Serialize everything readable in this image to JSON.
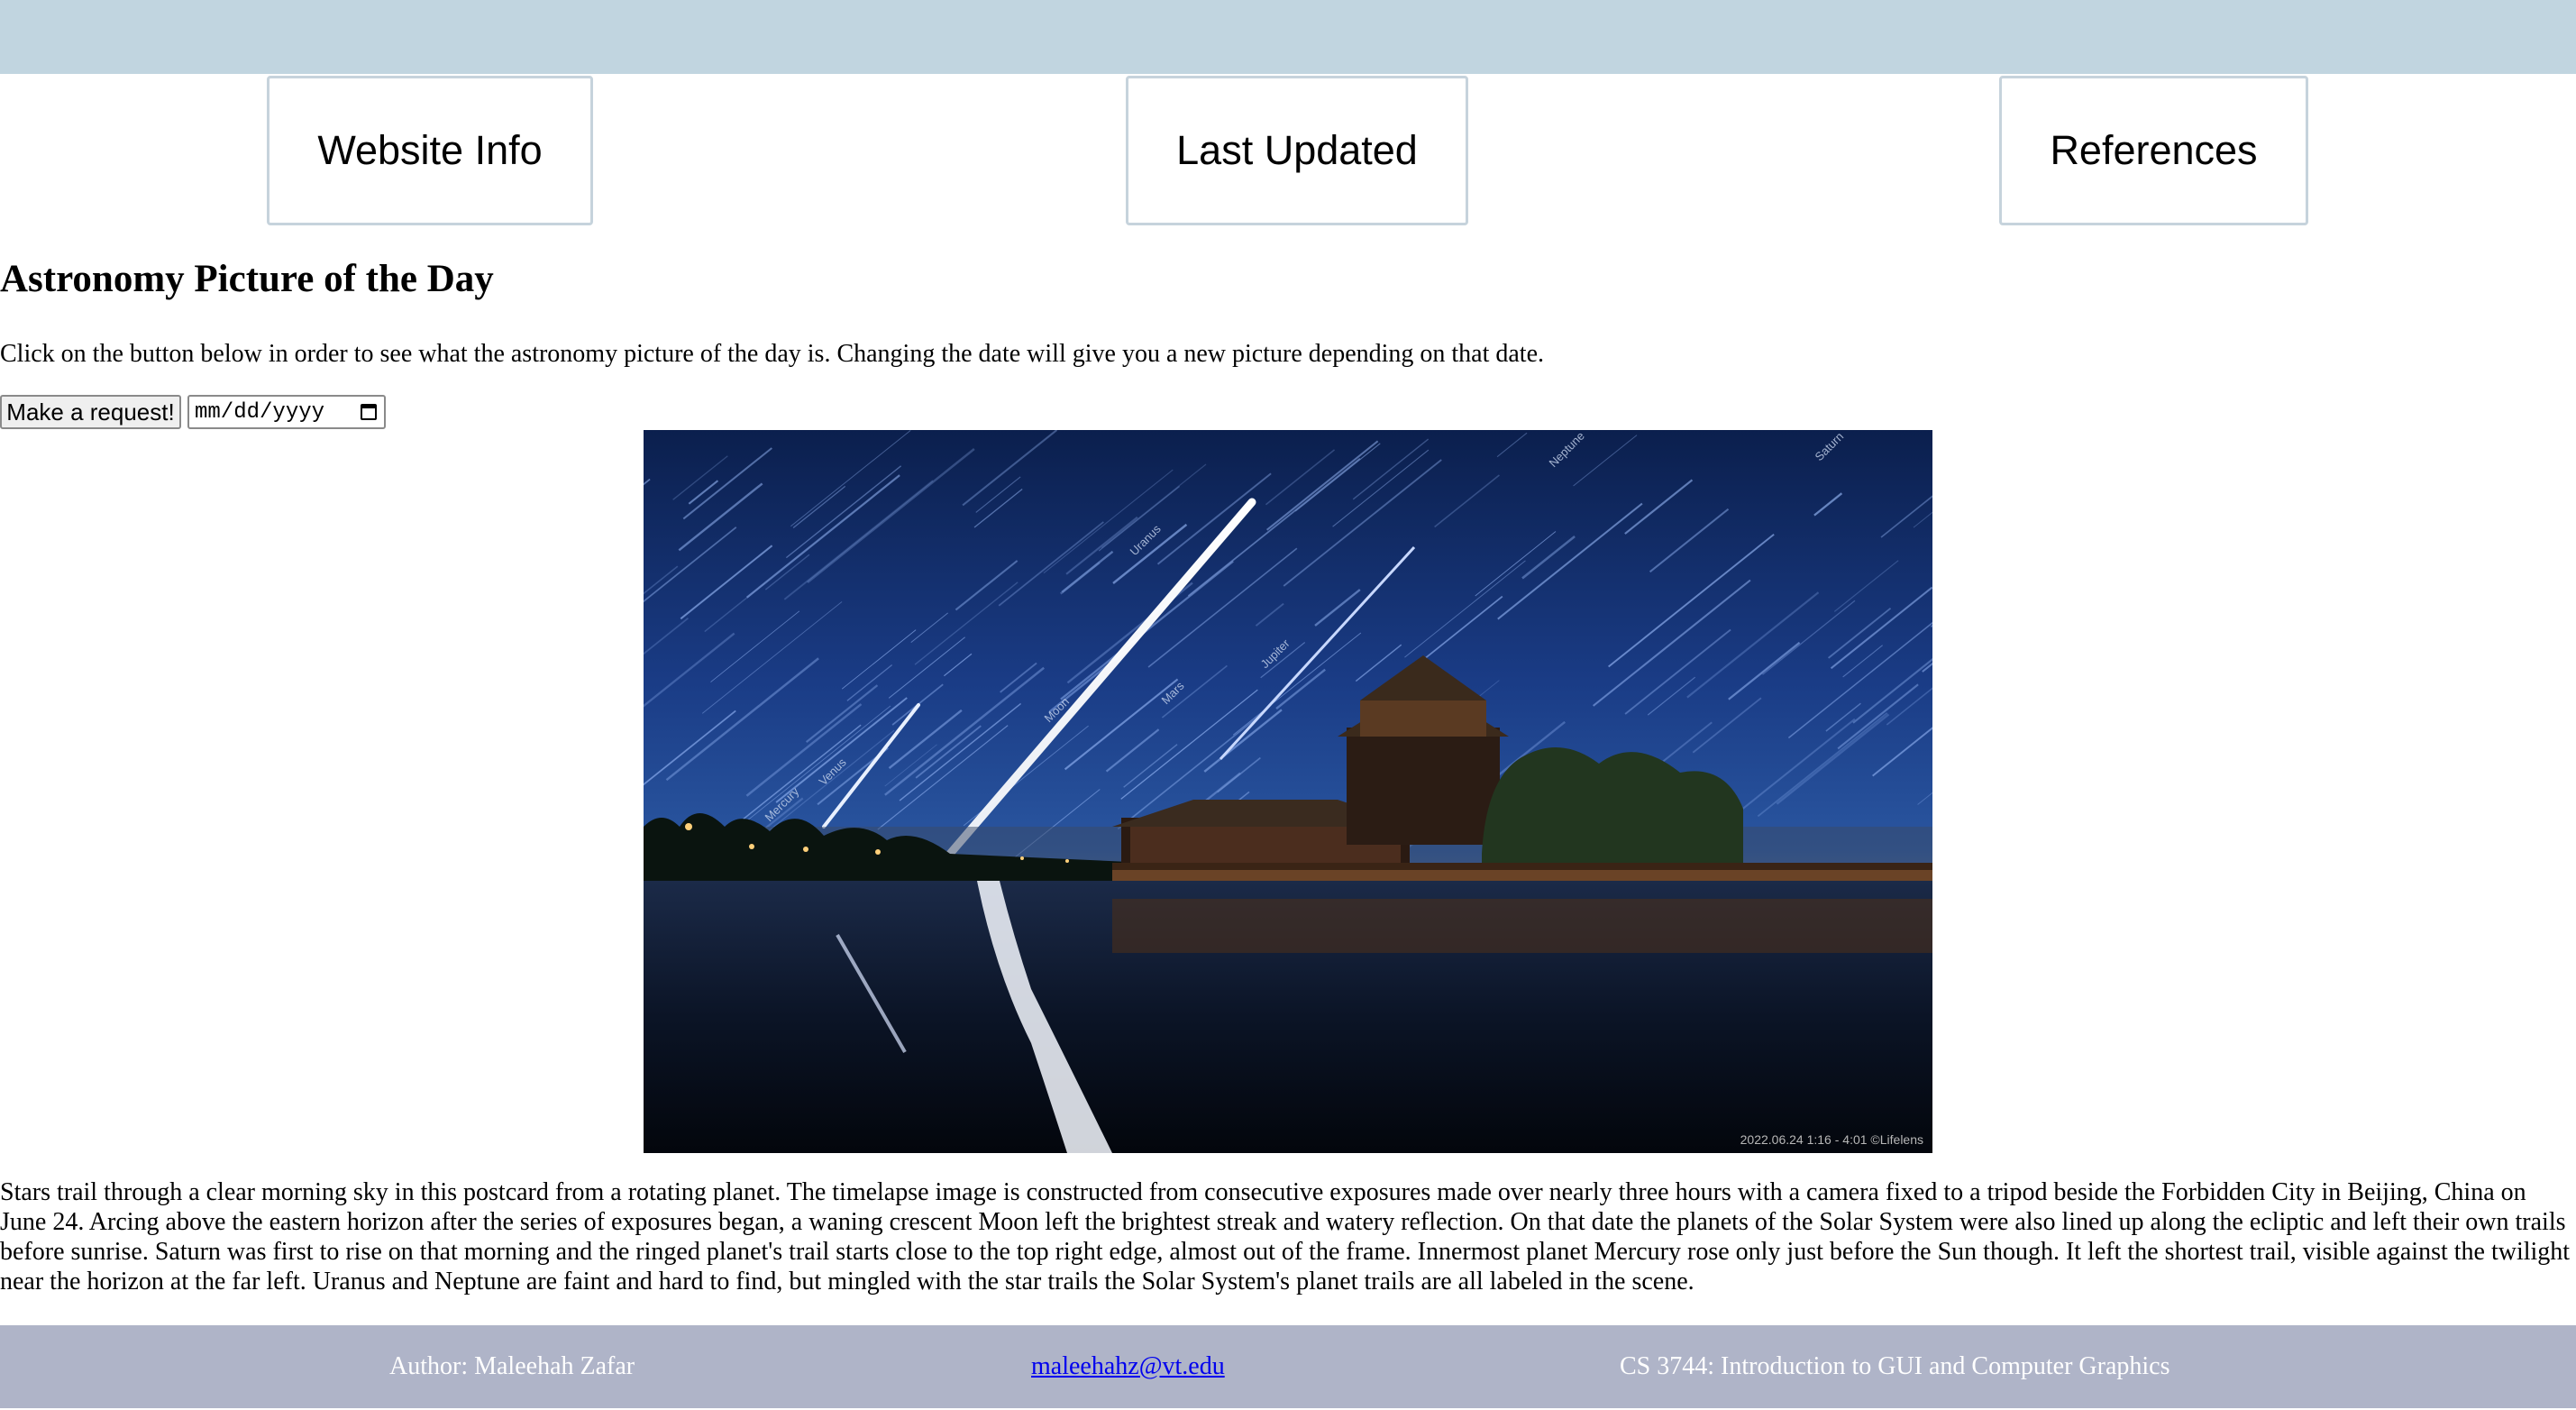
{
  "nav": {
    "website_info": "Website Info",
    "last_updated": "Last Updated",
    "references": "References"
  },
  "main": {
    "title": "Astronomy Picture of the Day",
    "intro": "Click on the button below in order to see what the astronomy picture of the day is. Changing the date will give you a new picture depending on that date.",
    "request_button": "Make a request!",
    "date_placeholder": "mm/dd/yyyy",
    "image": {
      "caption_stamp": "2022.06.24 1:16 - 4:01  ©Lifelens",
      "planet_labels": [
        "Mercury",
        "Venus",
        "Moon",
        "Mars",
        "Jupiter",
        "Uranus",
        "Neptune",
        "Saturn"
      ]
    },
    "explanation": "Stars trail through a clear morning sky in this postcard from a rotating planet. The timelapse image is constructed from consecutive exposures made over nearly three hours with a camera fixed to a tripod beside the Forbidden City in Beijing, China on June 24. Arcing above the eastern horizon after the series of exposures began, a waning crescent Moon left the brightest streak and watery reflection. On that date the planets of the Solar System were also lined up along the ecliptic and left their own trails before sunrise. Saturn was first to rise on that morning and the ringed planet's trail starts close to the top right edge, almost out of the frame. Innermost planet Mercury rose only just before the Sun though. It left the shortest trail, visible against the twilight near the horizon at the far left. Uranus and Neptune are faint and hard to find, but mingled with the star trails the Solar System's planet trails are all labeled in the scene."
  },
  "footer": {
    "author": "Author: Maleehah Zafar",
    "email": "maleehahz@vt.edu",
    "course": "CS 3744: Introduction to GUI and Computer Graphics"
  },
  "colors": {
    "top_bar": "#c1d5e0",
    "nav_border": "#c6d3dc",
    "footer_bg": "#afb4c8",
    "link": "#0000ee"
  }
}
